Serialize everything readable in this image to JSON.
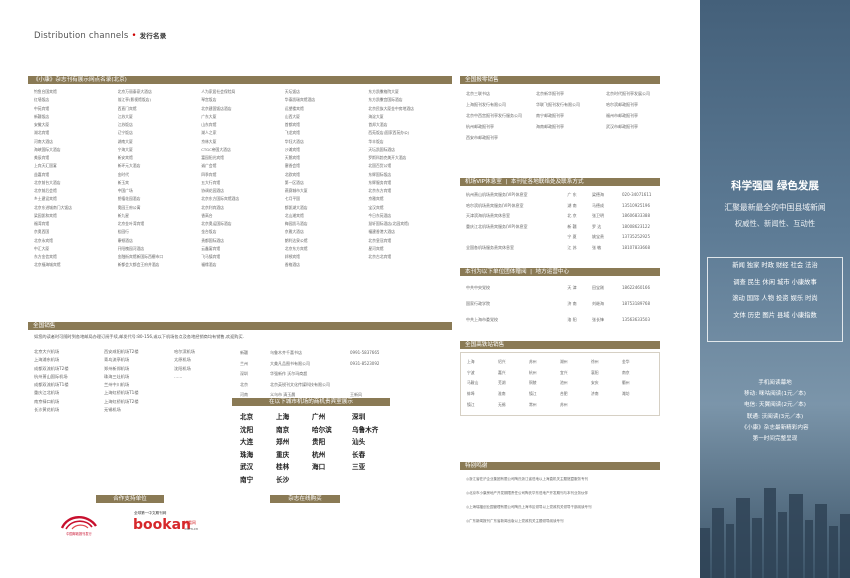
{
  "header": {
    "title": "Distribution  channels",
    "subtitle": "发行名录"
  },
  "left": {
    "display_header": "《小康》杂志刊有展示网点名录(北京)",
    "display_venues": [
      "钓鱼台国宾馆",
      "北京万丽泰豪大酒店",
      "人为家居社会保险局",
      "天坛饭店",
      "东方凯撒格院大厦",
      "红墙饭店",
      "翁江亭(影视馆饭店)",
      "琴宫饭店",
      "华泰凯瑞宾馆酒店",
      "东方凯撒宫国际酒店",
      "中苑宾馆",
      "西直门宾馆",
      "北京建国饭店酒店",
      "远望楼宾馆",
      "北京民族大厦金中房地酒店",
      "新疆饭店",
      "江苏大厦",
      "广东大厦",
      "山西大厦",
      "海淀大厦",
      "安徽大厦",
      "江苏饭店",
      "山东宾馆",
      "首都宾馆",
      "首邦大酒店",
      "湖北宾馆",
      "辽宁饭店",
      "湖人之家",
      "飞龙宾馆",
      "西苑饭店(国家西苑办公)",
      "河南大酒店",
      "湖南大厦",
      "京林大厦",
      "华钰大酒店",
      "华丰饭店",
      "海峡国际大酒店",
      "宁海大厦",
      "CTGC帝国大酒店",
      "沙滩宾馆",
      "天坛凯国际酒店",
      "美辰宾馆",
      "新安宾馆",
      "富园阳光宾馆",
      "天鹅宾馆",
      "罗斯科勃克美开大酒店",
      "上宾天汇国宴",
      "新环元大酒店",
      "诚广会馆",
      "塞香会馆",
      "北国百货公馆",
      "益嘉宾馆",
      "金时代",
      "四季宾馆",
      "北欧宾馆",
      "东辉国际饭店",
      "北京前台大酒店",
      "新玉宾",
      "五大行宾馆",
      "第一区酒店",
      "东辉服务宾馆",
      "北京前后会馆",
      "中国广场",
      "协调花园酒店",
      "燕赛城市大厦",
      "北京东方宾馆",
      "乡土建设宾馆",
      "钥禧花园酒店",
      "北京东方国际宾馆酒店",
      "七月平国",
      "京雅宾馆",
      "北京东进城南门大饭店",
      "奥园王府公寓",
      "北京利宾酒店",
      "都凯湖大酒店",
      "宝汉宾馆",
      "梁园凯和宾馆",
      "新九星",
      "香高台",
      "北山湘宾馆",
      "今日东苑酒店",
      "福湾宾馆",
      "北京金叶湾宾馆",
      "北京奥运国际酒店",
      "梅园凯马酒店",
      "慧轩国际酒店(北园宾馆)",
      "京奥西国",
      "松园行",
      "金台饭店",
      "京雅大酒店",
      "福建香港大酒店",
      "北京永宾馆",
      "康顿酒店",
      "贵都国际酒店",
      "朗利达泉公馆",
      "北京皇冠宾馆",
      "中汇大厦",
      "开阳槐园河酒店",
      "云鑫宴宾馆",
      "北京东方宾馆",
      "星河宾馆",
      "东方金信宾馆",
      "金融街宾馆新国际西栅市口",
      "飞马镇宾馆",
      "邦顿宾馆",
      "北京古北宾馆",
      "北京福海城宾馆",
      "新都会大都会王府井酒店",
      "福缘酒店",
      "香格酒店",
      ""
    ],
    "airport_header": "全国销售",
    "airport_note": "如您的读者时可随时到各地邮局办理订阅手续,邮发代号:80-156,或以下机场各点及各地经销商均有销售,欢迎购买.",
    "airports": [
      "北京大兴机场",
      "西安咸阳机场T2楼",
      "哈尔滨机场",
      "上海浦东机场",
      "青岛流亭机场",
      "太原机场",
      "成都双流机场T2楼",
      "郑州新郑机场",
      "沈阳机场",
      "杭州萧山国际机场",
      "珠海三灶机场",
      "……",
      "成都双流机场T1楼",
      "兰州中川机场",
      "",
      "重庆江北机场",
      "上海虹桥机场T1楼",
      "",
      "南京禄口机场",
      "上海虹桥机场T2楼",
      "",
      "长沙黄花机场",
      "无锡机场",
      ""
    ],
    "distributors": [
      [
        "新疆",
        "乌鲁木齐千喜书店",
        "0991-5837665"
      ],
      [
        "兰州",
        "大美凡品图书有限公司",
        "0931-8523092"
      ],
      [
        "深圳",
        "华强新作 沃尔玛商超",
        ""
      ],
      [
        "北京",
        "北京英锐刊文化传媒科技有限公司",
        ""
      ],
      [
        "河南",
        "义乌市 清玉晨",
        "王新风"
      ]
    ],
    "city_header": "在以下城市机场的商机贵宾室展示",
    "cities": [
      "北京",
      "上海",
      "广州",
      "深圳",
      "沈阳",
      "南京",
      "哈尔滨",
      "乌鲁木齐",
      "大连",
      "郑州",
      "贵阳",
      "汕头",
      "珠海",
      "重庆",
      "杭州",
      "长春",
      "武汉",
      "桂林",
      "海口",
      "三亚",
      "南宁",
      "长沙",
      "",
      ""
    ],
    "partners_header": "合作支持单位",
    "online_header": "杂志在线购买",
    "logo1_caption": "中国邮政报刊发行",
    "logo2_top": "全球第一中文期刊网",
    "logo2_main": "bookan",
    "logo2_sub": "博看网",
    "logo2_url": ".com.cn"
  },
  "mid": {
    "retail_header": "全国报零销售",
    "retail": [
      [
        "北京三联书店",
        "北京新华报刊亭",
        "北京时代报刊亭发展公司"
      ],
      [
        "上海报刊发行有限公司",
        "华联飞报刊发行有限公司",
        "哈尔滨邮政报刊亭"
      ],
      [
        "北京中西宫报刊亭发行服务公司",
        "南宁邮政报刊亭",
        "福州市邮政报刊亭"
      ],
      [
        "杭州邮政报刊亭",
        "海南邮政报刊亭",
        "武汉市邮政报刊亭"
      ],
      [
        "西安市邮政报刊亭",
        "",
        ""
      ]
    ],
    "vip_header_a": "机场VIP休息室",
    "vip_header_b": "本刊征各地联络处及联系方式",
    "vip_rows": [
      [
        "杭州萧山机场贵宾服务(VIP)休息室",
        "广  东",
        "梁德海",
        "020-34071611"
      ],
      [
        "哈尔滨机场贵宾服务(VIP)休息室",
        "湖  南",
        "马德成",
        "13510925196"
      ],
      [
        "天津滨海机场贵宾休息室",
        "北  京",
        "张卫明",
        "18606833388"
      ],
      [
        "重庆江北机场贵宾服务(VIP)休息室",
        "新  疆",
        "罗  达",
        "18008623122"
      ],
      [
        "",
        "宁  夏",
        "姚宝贵",
        "13735252925"
      ],
      [
        "全国各机场服务贵宾休息室",
        "江  苏",
        "张  敏",
        "18107833668"
      ]
    ],
    "liaison_header_a": "本刊为以下单位团体赠阅",
    "liaison_header_b": "地方运营中心",
    "liaison_rows": [
      [
        "中共中央党校",
        "天  津",
        "田宝刚",
        "18622460166"
      ],
      [
        "国家行政学院",
        "济  南",
        "刘继海",
        "18753189768"
      ],
      [
        "中共上海市委党校",
        "洛  阳",
        "张长锋",
        "13563633503"
      ]
    ],
    "dept_header": "全国高铁站销售",
    "stations": [
      "上海",
      "绍兴",
      "苏州",
      "湖州",
      "徐州",
      "金华",
      "宁波",
      "嘉兴",
      "杭州",
      "宜兴",
      "襄阳",
      "南京",
      "马鞍山",
      "芜湖",
      "铜陵",
      "池州",
      "安庆",
      "衢州",
      "蚌埠",
      "淮南",
      "镇江",
      "合肥",
      "济南",
      "潍坊",
      "镇江",
      "无锡",
      "常州",
      "苏州",
      "",
      ""
    ],
    "special_header": "特别鸣谢",
    "specials": [
      "◎浙江省驻沪企业集团有限公司陶氏浙江省驻地以上海直机关主题馆暨服务专刊",
      "◎北京市小康房地产开发期限责任公司陶氏华东驻地产开发期刊与本刊业务伙伴",
      "◎上海瑞福创业园管理有限公司陶氏上海市区领导以上党政机关领导干部阅读专刊",
      "◎广东新闻报刊广东省新闻出版以上党政机关主题领导阅读专刊"
    ]
  },
  "right": {
    "headline": "科学强国 绿色发展",
    "subhead": "汇聚最新最全的中国县域新闻",
    "tagline": "权威性、新闻性、互动性",
    "box_lines": [
      "新闻 独家 时政 财经 社会 法治",
      "调查 民生 休闲 城市 小康故事",
      "滚动 国际 人物 投资 娱乐 时尚",
      "文体 历史 图片 县域 小康指数"
    ],
    "mobile_lines": [
      "手机阅读幕地",
      "移动: 咪咕阅读(1元／本)",
      "电信: 天翼阅读(2元／本)",
      "联通: 沃阅读(3元／本)",
      "《小康》杂志最新精彩内容",
      "第一时间完整呈现"
    ]
  }
}
